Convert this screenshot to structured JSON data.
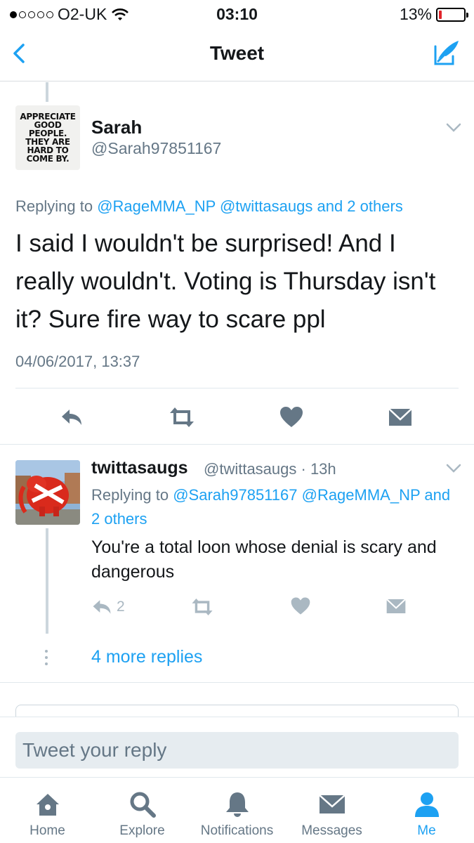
{
  "status_bar": {
    "carrier": "O2-UK",
    "time": "03:10",
    "battery_percent": "13%",
    "battery_level": 0.13,
    "signal_bars": 1,
    "signal_total": 5
  },
  "nav": {
    "title": "Tweet",
    "back_icon": "chevron-left-icon",
    "compose_icon": "compose-icon"
  },
  "main_tweet": {
    "avatar_text": [
      "APPRECIATE",
      "GOOD",
      "PEOPLE.",
      "THEY ARE",
      "HARD TO",
      "COME BY."
    ],
    "name": "Sarah",
    "handle": "@Sarah97851167",
    "replying_prefix": "Replying to",
    "replying_mentions": "@RageMMA_NP @twittasaugs and 2 others",
    "text": "I said I wouldn't be surprised! And I really wouldn't. Voting is Thursday isn't it? Sure fire way to scare ppl",
    "timestamp": "04/06/2017, 13:37"
  },
  "reply_tweet": {
    "name": "twittasaugs",
    "handle_time": "@twittasaugs · 13h",
    "replying_prefix": "Replying to",
    "replying_mentions": "@Sarah97851167 @RageMMA_NP and 2 others",
    "text": "You're a total loon whose denial is scary and dangerous",
    "reply_count": "2"
  },
  "more_replies": "4 more replies",
  "composer": {
    "placeholder": "Tweet your reply"
  },
  "tabs": [
    {
      "label": "Home",
      "icon": "home-icon"
    },
    {
      "label": "Explore",
      "icon": "search-icon"
    },
    {
      "label": "Notifications",
      "icon": "bell-icon"
    },
    {
      "label": "Messages",
      "icon": "envelope-icon"
    },
    {
      "label": "Me",
      "icon": "person-icon",
      "active": true
    }
  ],
  "colors": {
    "accent": "#1da1f2",
    "secondary_text": "#657786",
    "icon_gray": "#657786",
    "light_icon": "#aab8c2",
    "battery_low": "#e0242a"
  }
}
